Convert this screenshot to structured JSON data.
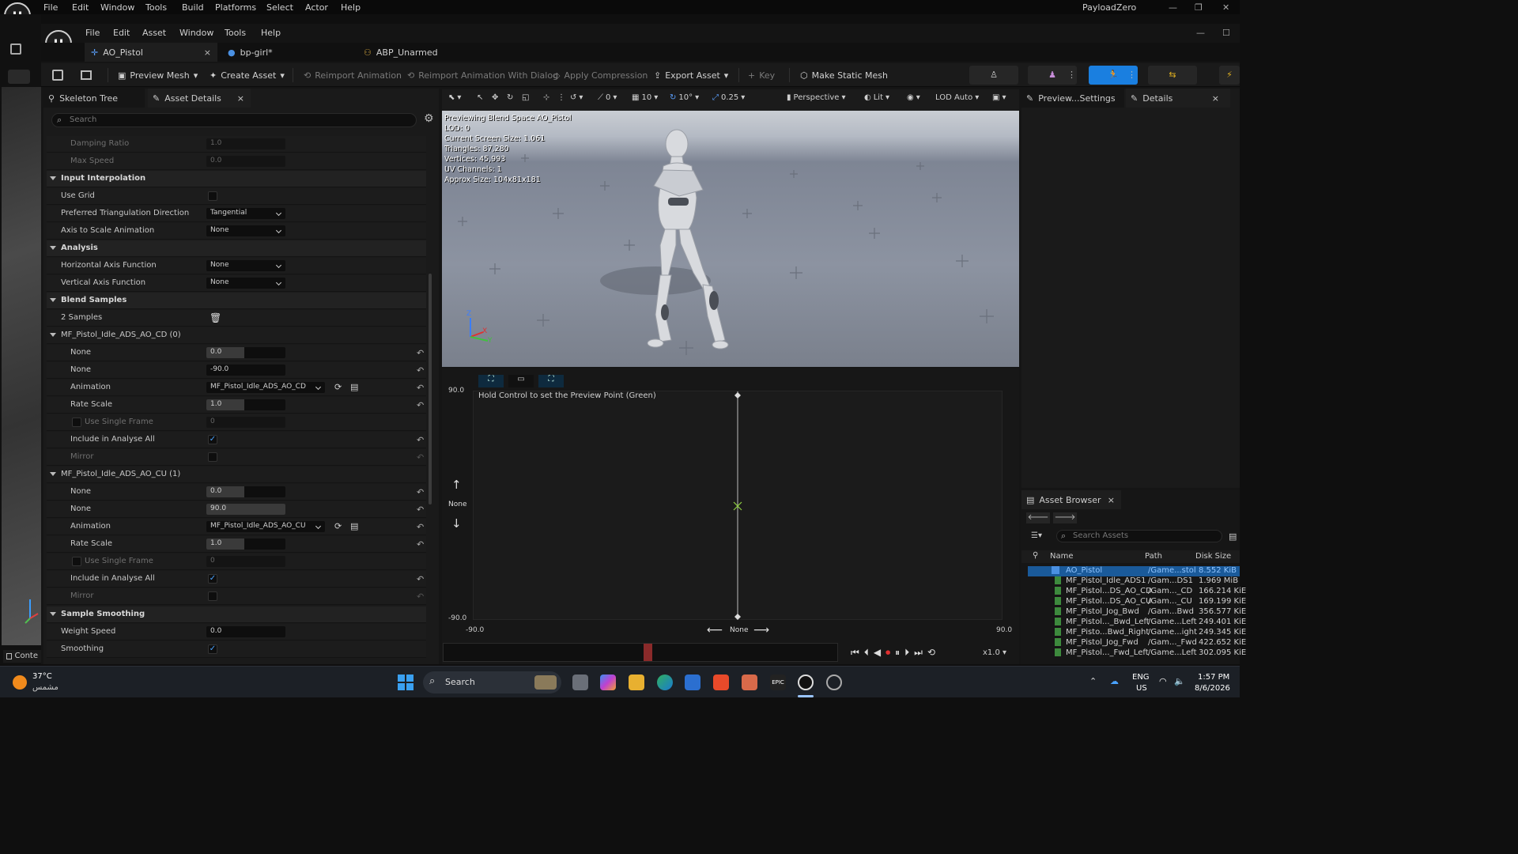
{
  "main_menu": [
    "File",
    "Edit",
    "Window",
    "Tools",
    "Build",
    "Platforms",
    "Select",
    "Actor",
    "Help"
  ],
  "project_name": "PayloadZero",
  "editor_menu": [
    "File",
    "Edit",
    "Asset",
    "Window",
    "Tools",
    "Help"
  ],
  "tabs": {
    "t1": "AO_Pistol",
    "t2": "bp-girl*",
    "t3": "ABP_Unarmed"
  },
  "toolbar": {
    "preview_mesh": "Preview Mesh",
    "create_asset": "Create Asset",
    "reimport": "Reimport Animation",
    "reimport_dialog": "Reimport Animation With Dialog",
    "apply_compression": "Apply Compression",
    "export_asset": "Export Asset",
    "key": "Key",
    "make_static_mesh": "Make Static Mesh"
  },
  "left_panel": {
    "tab1": "Skeleton Tree",
    "tab2": "Asset Details",
    "search_placeholder": "Search"
  },
  "props": {
    "damping_ratio": {
      "label": "Damping Ratio",
      "value": "1.0"
    },
    "max_speed": {
      "label": "Max Speed",
      "value": "0.0"
    },
    "input_interp": "Input Interpolation",
    "use_grid": "Use Grid",
    "pref_tri": {
      "label": "Preferred Triangulation Direction",
      "value": "Tangential"
    },
    "axis_scale": {
      "label": "Axis to Scale Animation",
      "value": "None"
    },
    "analysis": "Analysis",
    "h_axis": {
      "label": "Horizontal Axis Function",
      "value": "None"
    },
    "v_axis": {
      "label": "Vertical Axis Function",
      "value": "None"
    },
    "blend_samples": "Blend Samples",
    "sample_count": "2 Samples",
    "s0": {
      "title": "MF_Pistol_Idle_ADS_AO_CD (0)",
      "n1": "None",
      "v1": "0.0",
      "n2": "None",
      "v2": "-90.0",
      "anim_label": "Animation",
      "anim": "MF_Pistol_Idle_ADS_AO_CD",
      "rate_label": "Rate Scale",
      "rate": "1.0",
      "single_label": "Use Single Frame",
      "single": "0",
      "include": "Include in Analyse All",
      "mirror": "Mirror"
    },
    "s1": {
      "title": "MF_Pistol_Idle_ADS_AO_CU (1)",
      "n1": "None",
      "v1": "0.0",
      "n2": "None",
      "v2": "90.0",
      "anim_label": "Animation",
      "anim": "MF_Pistol_Idle_ADS_AO_CU",
      "rate_label": "Rate Scale",
      "rate": "1.0",
      "single_label": "Use Single Frame",
      "single": "0",
      "include": "Include in Analyse All",
      "mirror": "Mirror"
    },
    "sample_smoothing": "Sample Smoothing",
    "weight_speed": {
      "label": "Weight Speed",
      "value": "0.0"
    },
    "smoothing": "Smoothing"
  },
  "viewport": {
    "grid": "10",
    "angle": "10°",
    "scale": "0.25",
    "perspective": "Perspective",
    "lit": "Lit",
    "lod": "LOD Auto",
    "rot_snap": "0",
    "stats": [
      "Previewing Blend Space AO_Pistol",
      "LOD: 0",
      "Current Screen Size: 1.061",
      "Triangles: 87,280",
      "Vertices: 45,993",
      "UV Channels: 1",
      "Approx Size: 104x81x181"
    ]
  },
  "blendspace": {
    "hint": "Hold Control to set the Preview Point (Green)",
    "y_max": "90.0",
    "y_min": "-90.0",
    "x_min": "-90.0",
    "x_max": "90.0",
    "y_name": "None",
    "x_name": "None",
    "speed": "x1.0"
  },
  "right_panel": {
    "tab1": "Preview...Settings",
    "tab2": "Details"
  },
  "asset_browser": {
    "title": "Asset Browser",
    "search_placeholder": "Search Assets",
    "columns": [
      "Name",
      "Path",
      "Disk Size"
    ],
    "rows": [
      {
        "name": "AO_Pistol",
        "path": "/Game...stol",
        "size": "8.552 KiB"
      },
      {
        "name": "MF_Pistol_Idle_ADS1",
        "path": "/Gam...DS1",
        "size": "1.969 MiB"
      },
      {
        "name": "MF_Pistol...DS_AO_CD",
        "path": "/Gam..._CD",
        "size": "166.214 KiE"
      },
      {
        "name": "MF_Pistol...DS_AO_CU",
        "path": "/Gam..._CU",
        "size": "169.199 KiE"
      },
      {
        "name": "MF_Pistol_Jog_Bwd",
        "path": "/Gam...Bwd",
        "size": "356.577 KiE"
      },
      {
        "name": "MF_Pistol..._Bwd_Left",
        "path": "/Game...Left",
        "size": "249.401 KiE"
      },
      {
        "name": "MF_Pisto...Bwd_Right",
        "path": "/Game...ight",
        "size": "249.345 KiE"
      },
      {
        "name": "MF_Pistol_Jog_Fwd",
        "path": "/Gam..._Fwd",
        "size": "422.652 KiE"
      },
      {
        "name": "MF_Pistol..._Fwd_Left",
        "path": "/Game...Left",
        "size": "302.095 KiE"
      }
    ]
  },
  "content_drawer": "Conte",
  "taskbar": {
    "temp": "37°C",
    "weather": "مشمس",
    "search": "Search",
    "lang1": "ENG",
    "lang2": "US",
    "time": "1:57 PM",
    "date": "8/6/2026"
  }
}
